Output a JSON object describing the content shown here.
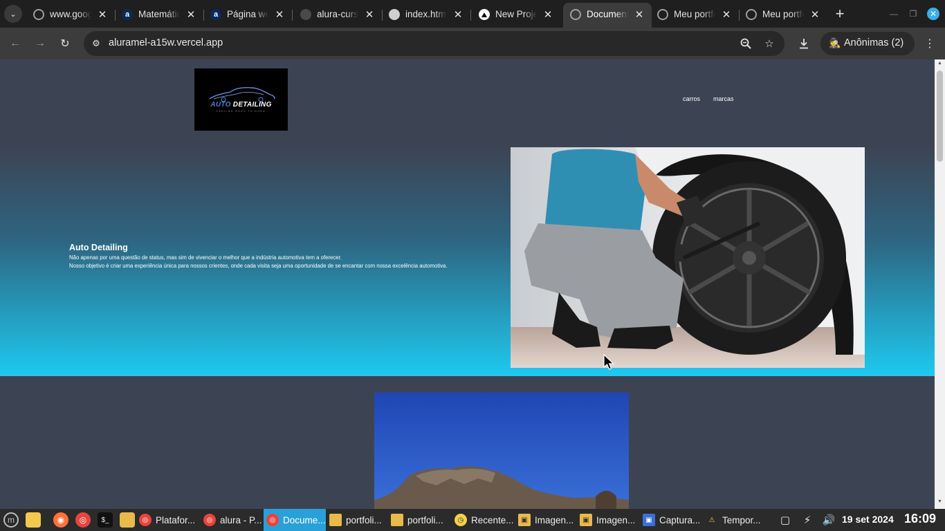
{
  "browser": {
    "tabs": [
      {
        "title": "www.google.com",
        "icon": "globe-icon",
        "active": false
      },
      {
        "title": "Matemática",
        "icon": "alura-icon",
        "active": false
      },
      {
        "title": "Página web",
        "icon": "alura-icon",
        "active": false
      },
      {
        "title": "alura-cursos",
        "icon": "github-icon",
        "active": false
      },
      {
        "title": "index.html",
        "icon": "github-icon",
        "active": false
      },
      {
        "title": "New Project",
        "icon": "vercel-icon",
        "active": false
      },
      {
        "title": "Document",
        "icon": "globe-icon",
        "active": true
      },
      {
        "title": "Meu portfolio",
        "icon": "globe-icon",
        "active": false
      },
      {
        "title": "Meu portfolio",
        "icon": "globe-icon",
        "active": false
      }
    ],
    "url": "aluramel-a15w.vercel.app",
    "incognito_label": "Anônimas (2)"
  },
  "site": {
    "logo": {
      "word1": "AUTO",
      "word2": "DETAILING",
      "tagline": "FEELING GOES TO ROAD"
    },
    "nav": [
      {
        "label": "carros"
      },
      {
        "label": "marcas"
      }
    ],
    "hero": {
      "title": "Auto Detailing",
      "line1": "Não apenas por uma questão de status, mas sim de vivenciar o melhor que a indústria automotiva tem a oferecer.",
      "line2": "Nosso objetivo é criar uma experiência única para nossos crientes, onde cada visita seja uma oportunidade de se encantar com nossa excelência automotiva."
    }
  },
  "taskbar": {
    "windows": [
      {
        "label": "Platafor...",
        "icon": "chrome-icon",
        "active": false
      },
      {
        "label": "alura - P...",
        "icon": "chrome-icon",
        "active": false
      },
      {
        "label": "Docume...",
        "icon": "chrome-icon",
        "active": true
      },
      {
        "label": "portfoli...",
        "icon": "folder-icon",
        "active": false
      },
      {
        "label": "portfoli...",
        "icon": "folder-icon",
        "active": false
      },
      {
        "label": "Recente...",
        "icon": "clock-icon",
        "active": false
      },
      {
        "label": "Imagen...",
        "icon": "camera-folder-icon",
        "active": false
      },
      {
        "label": "Imagen...",
        "icon": "camera-folder-icon",
        "active": false
      },
      {
        "label": "Captura...",
        "icon": "screenshot-icon",
        "active": false
      },
      {
        "label": "Tempor...",
        "icon": "warning-icon",
        "active": false
      }
    ],
    "date": "19 set 2024",
    "time": "16:09"
  },
  "colors": {
    "page_bg": "#3c4454",
    "hero_gradient_end": "#1ec9f0",
    "taskbar_active": "#2aa0d8"
  }
}
